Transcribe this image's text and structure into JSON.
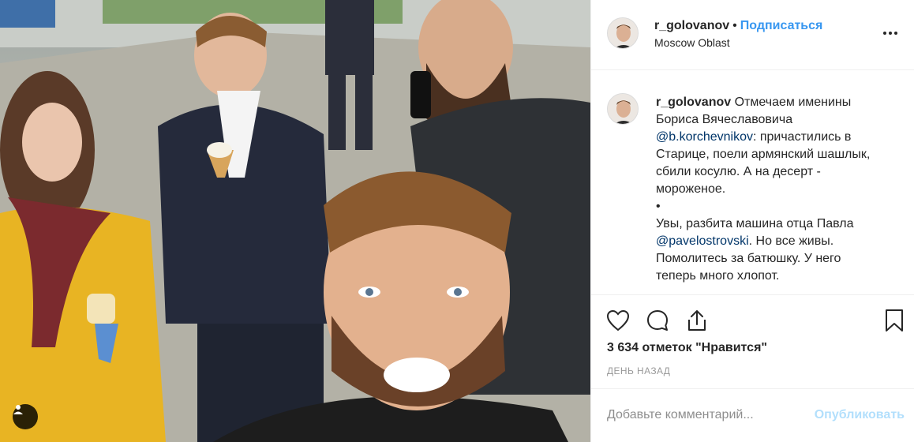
{
  "post": {
    "username": "r_golovanov",
    "separator": "•",
    "follow_label": "Подписаться",
    "location": "Moscow Oblast"
  },
  "caption": {
    "username": "r_golovanov",
    "line1_rest": "Отмечаем именины",
    "line2": "Бориса Вячеславовича",
    "mention1": "@b.korchevnikov",
    "line3_rest": ": причастились в",
    "line4": "Старице, поели армянский шашлык,",
    "line5": "сбили косулю. А на десерт -",
    "line6": "мороженое.",
    "bullet": "•",
    "line8": "Увы, разбита машина отца Павла",
    "mention2": "@pavelostrovski",
    "line9_rest": ". Но все живы.",
    "line10": "Помолитесь за батюшку. У него",
    "line11": "теперь много хлопот."
  },
  "stats": {
    "likes": "3 634 отметок \"Нравится\"",
    "time_ago": "ДЕНЬ НАЗАД"
  },
  "comment": {
    "placeholder": "Добавьте комментарий...",
    "publish_label": "Опубликовать"
  },
  "icons": {
    "like": "heart-icon",
    "comment": "comment-icon",
    "share": "share-icon",
    "save": "bookmark-icon",
    "more": "more-icon",
    "tag": "user-tag-icon"
  },
  "colors": {
    "link": "#3897f0",
    "mention": "#003569",
    "publish_disabled": "#b2dffc",
    "border": "#efefef"
  }
}
